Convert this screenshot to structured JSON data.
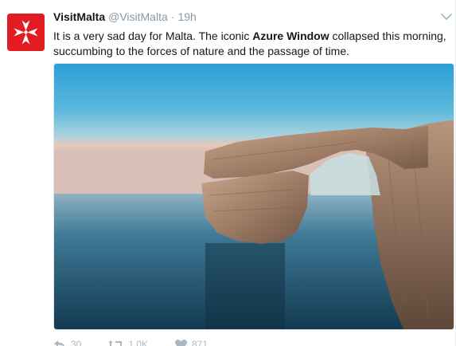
{
  "tweet": {
    "author_name": "VisitMalta",
    "author_handle": "@VisitMalta",
    "separator": "·",
    "time": "19h",
    "text_before": "It is a very sad day for Malta. The iconic ",
    "text_bold": "Azure Window",
    "text_after": " collapsed this morning, succumbing to the forces of nature and the passage of time.",
    "avatar_color": "#e31b23",
    "avatar_icon": "maltese-cross-icon",
    "media_alt": "Azure Window rock arch over the sea"
  },
  "actions": {
    "reply_count": "30",
    "retweet_count": "1.0K",
    "like_count": "871",
    "reply_icon": "reply-icon",
    "retweet_icon": "retweet-icon",
    "like_icon": "heart-icon"
  },
  "colors": {
    "text": "#14171a",
    "muted": "#8899a6",
    "action": "#aab8c2"
  }
}
